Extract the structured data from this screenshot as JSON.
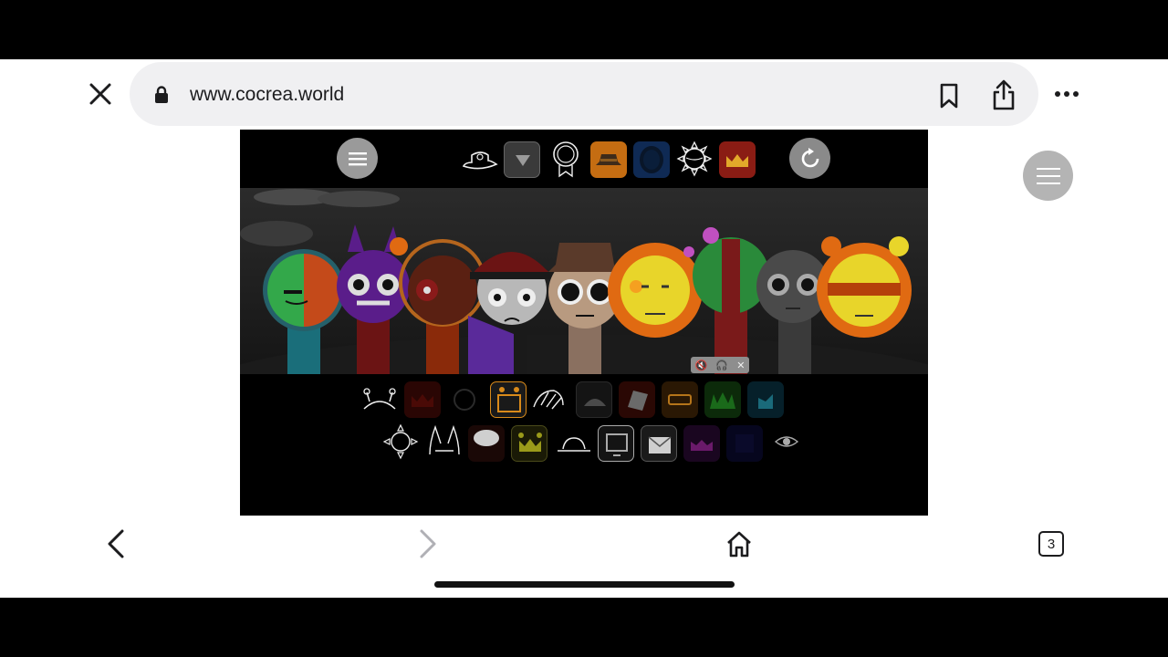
{
  "browser": {
    "url": "www.cocrea.world",
    "tab_count": "3"
  },
  "game": {
    "top_icons": [
      "hat-outline",
      "dropdown-arrow",
      "medal-outline",
      "hat-orange",
      "head-blue",
      "sun-outline",
      "crown-red"
    ],
    "bottom_row1": [
      "antenna-outline",
      "crown-dark-red",
      "ring-dark",
      "frame-orange",
      "hair-outline",
      "hat-grey",
      "tilted-hat",
      "glasses-orange",
      "grass-green",
      "blue-shape"
    ],
    "bottom_row2": [
      "sun-outline",
      "horns-outline",
      "speech-bubble",
      "crown-yellow",
      "bowler-outline",
      "monitor-outline",
      "envelope",
      "purple-crown",
      "blue-dark",
      "eye-outline"
    ],
    "media_controls": [
      "mute-icon",
      "headphones-icon",
      "close-icon"
    ]
  },
  "colors": {
    "stage_bg": "#2b2b2b",
    "accent_orange": "#ff8a1a",
    "accent_yellow": "#f2e11d",
    "menu_button": "#9a9a9a"
  }
}
